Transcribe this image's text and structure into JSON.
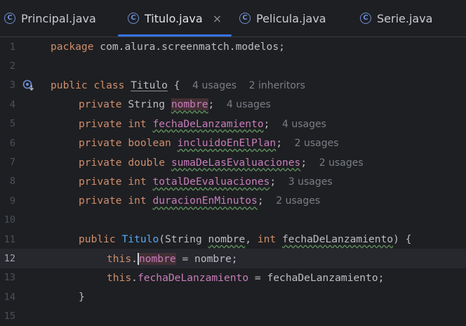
{
  "tabs": [
    {
      "label": "Principal.java",
      "icon": "class-icon",
      "active": false
    },
    {
      "label": "Titulo.java",
      "icon": "class-icon",
      "active": true,
      "close": "×"
    },
    {
      "label": "Pelicula.java",
      "icon": "class-icon",
      "active": false
    },
    {
      "label": "Serie.java",
      "icon": "class-icon",
      "active": false
    }
  ],
  "icon_glyph": "C",
  "editor": {
    "current_line": 12,
    "line_numbers": [
      "1",
      "2",
      "3",
      "4",
      "5",
      "6",
      "7",
      "8",
      "9",
      "10",
      "11",
      "12",
      "13",
      "14",
      "15"
    ],
    "l1": {
      "kw": "package",
      "rest": " com.alura.screenmatch.modelos;"
    },
    "l3": {
      "kw1": "public",
      "kw2": "class",
      "name": "Titulo",
      "brace": " {",
      "hint1": "4 usages",
      "hint2": "2 inheritors"
    },
    "l4": {
      "kw": "private",
      "type": "String",
      "name": "nombre",
      "semi": ";",
      "hint": "4 usages"
    },
    "l5": {
      "kw": "private",
      "type": "int",
      "name": "fechaDeLanzamiento",
      "semi": ";",
      "hint": "4 usages"
    },
    "l6": {
      "kw": "private",
      "type": "boolean",
      "name": "incluidoEnElPlan",
      "semi": ";",
      "hint": "2 usages"
    },
    "l7": {
      "kw": "private",
      "type": "double",
      "name": "sumaDeLasEvaluaciones",
      "semi": ";",
      "hint": "2 usages"
    },
    "l8": {
      "kw": "private",
      "type": "int",
      "name": "totalDeEvaluaciones",
      "semi": ";",
      "hint": "3 usages"
    },
    "l9": {
      "kw": "private",
      "type": "int",
      "name": "duracionEnMinutos",
      "semi": ";",
      "hint": "2 usages"
    },
    "l11": {
      "kw": "public",
      "name": "Titulo",
      "p1": "(String ",
      "a1": "nombre",
      "p2": ", ",
      "kw2": "int",
      "p3": " ",
      "a2": "fechaDeLanzamiento",
      "p4": ") {"
    },
    "l12": {
      "kw": "this",
      "dot": ".",
      "name": "nombre",
      "rest": " = nombre;"
    },
    "l13": {
      "kw": "this",
      "dot": ".",
      "name": "fechaDeLanzamiento",
      "rest": " = fechaDeLanzamiento;"
    },
    "l14": {
      "text": "}"
    }
  },
  "colors": {
    "keyword": "#cf8e6d",
    "field": "#c77dbb",
    "accent": "#3574f0",
    "background": "#1e1f22"
  }
}
